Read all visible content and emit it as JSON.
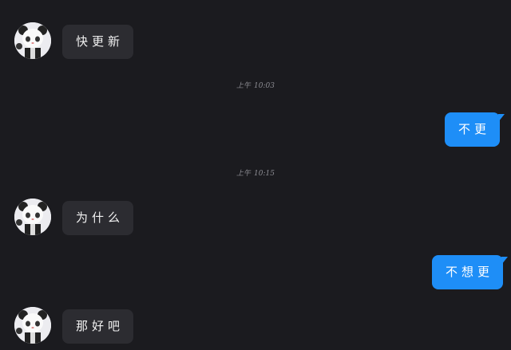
{
  "colors": {
    "background": "#1b1b1f",
    "incoming_bubble": "#2c2c31",
    "outgoing_bubble": "#1e8ef7",
    "timestamp": "#8c8c92"
  },
  "messages": [
    {
      "side": "incoming",
      "text": "快更新",
      "avatar": "panda-avatar-icon"
    },
    {
      "type": "timestamp",
      "period": "上午",
      "time": "10:03"
    },
    {
      "side": "outgoing",
      "text": "不更"
    },
    {
      "type": "timestamp",
      "period": "上午",
      "time": "10:15"
    },
    {
      "side": "incoming",
      "text": "为什么",
      "avatar": "panda-avatar-icon"
    },
    {
      "side": "outgoing",
      "text": "不想更"
    },
    {
      "side": "incoming",
      "text": "那好吧",
      "avatar": "panda-avatar-icon"
    }
  ]
}
